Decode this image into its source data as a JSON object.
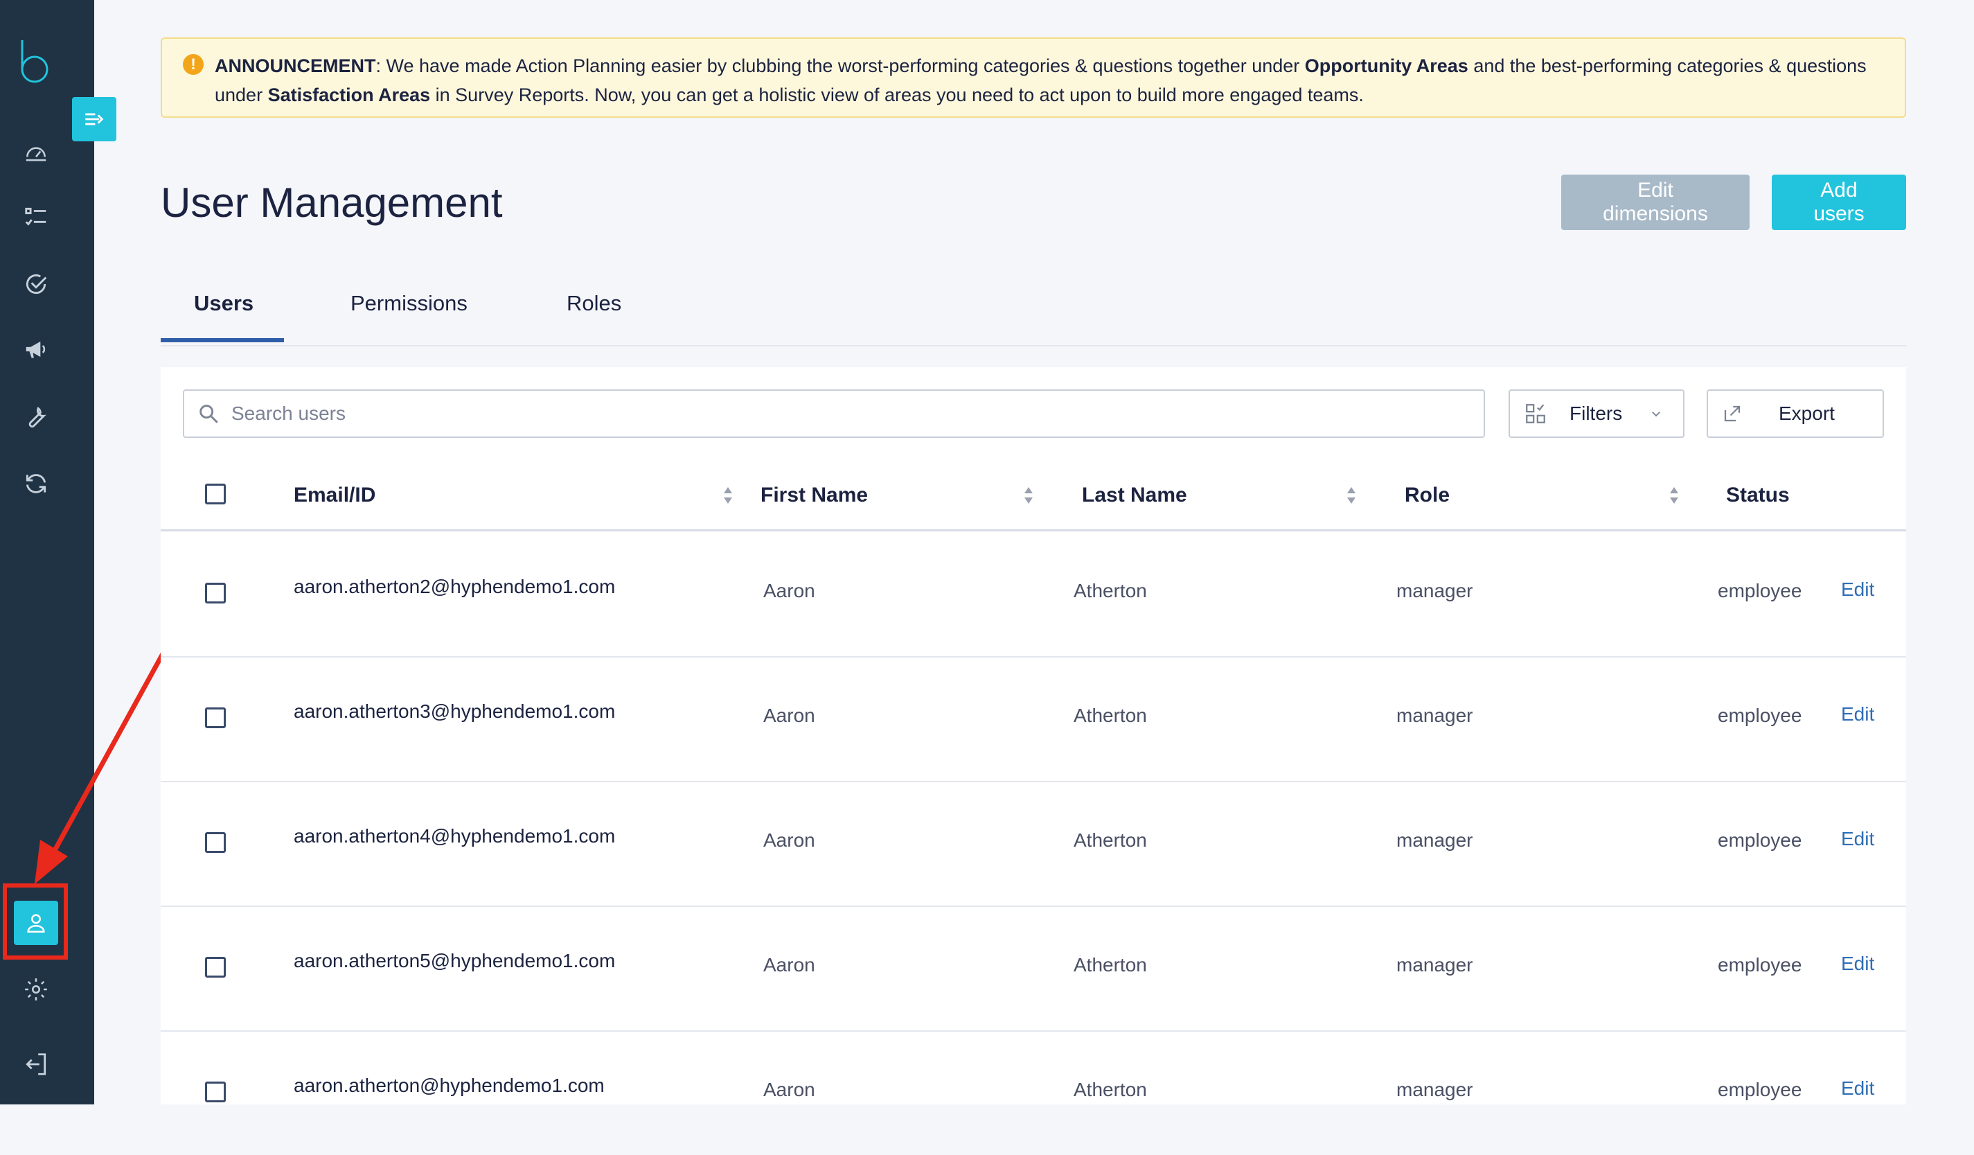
{
  "announcement": {
    "label": "ANNOUNCEMENT",
    "text_1": ": We have made Action Planning easier by clubbing the worst-performing categories & questions  together under ",
    "bold_1": "Opportunity Areas",
    "text_2": " and the best-performing  categories & questions under ",
    "bold_2": "Satisfaction Areas",
    "text_3": " in Survey Reports.  Now, you can get a holistic view of areas you need to act upon to build more engaged teams."
  },
  "header": {
    "title": "User Management",
    "edit_dimensions": "Edit dimensions",
    "add_users": "Add users"
  },
  "tabs": [
    {
      "label": "Users",
      "active": true
    },
    {
      "label": "Permissions",
      "active": false
    },
    {
      "label": "Roles",
      "active": false
    }
  ],
  "toolbar": {
    "search_placeholder": "Search users",
    "filters": "Filters",
    "export": "Export"
  },
  "table": {
    "columns": [
      "Email/ID",
      "First Name",
      "Last Name",
      "Role",
      "Status"
    ],
    "rows": [
      {
        "email": "aaron.atherton2@hyphendemo1.com",
        "first": "Aaron",
        "last": "Atherton",
        "role": "manager",
        "status": "employee",
        "action": "Edit"
      },
      {
        "email": "aaron.atherton3@hyphendemo1.com",
        "first": "Aaron",
        "last": "Atherton",
        "role": "manager",
        "status": "employee",
        "action": "Edit"
      },
      {
        "email": "aaron.atherton4@hyphendemo1.com",
        "first": "Aaron",
        "last": "Atherton",
        "role": "manager",
        "status": "employee",
        "action": "Edit"
      },
      {
        "email": "aaron.atherton5@hyphendemo1.com",
        "first": "Aaron",
        "last": "Atherton",
        "role": "manager",
        "status": "employee",
        "action": "Edit"
      },
      {
        "email": "aaron.atherton@hyphendemo1.com",
        "first": "Aaron",
        "last": "Atherton",
        "role": "manager",
        "status": "employee",
        "action": "Edit"
      }
    ]
  },
  "sidebar": {
    "items": [
      {
        "icon": "dashboard-icon"
      },
      {
        "icon": "checklist-icon"
      },
      {
        "icon": "check-circle-icon"
      },
      {
        "icon": "megaphone-icon"
      },
      {
        "icon": "wrench-icon"
      },
      {
        "icon": "refresh-icon"
      },
      {
        "icon": "user-icon",
        "active": true
      },
      {
        "icon": "gear-icon"
      },
      {
        "icon": "logout-icon"
      }
    ]
  },
  "colors": {
    "sidebar": "#1f3344",
    "accent": "#22c3dc",
    "highlight": "#e8291c",
    "link": "#2f6db5"
  }
}
